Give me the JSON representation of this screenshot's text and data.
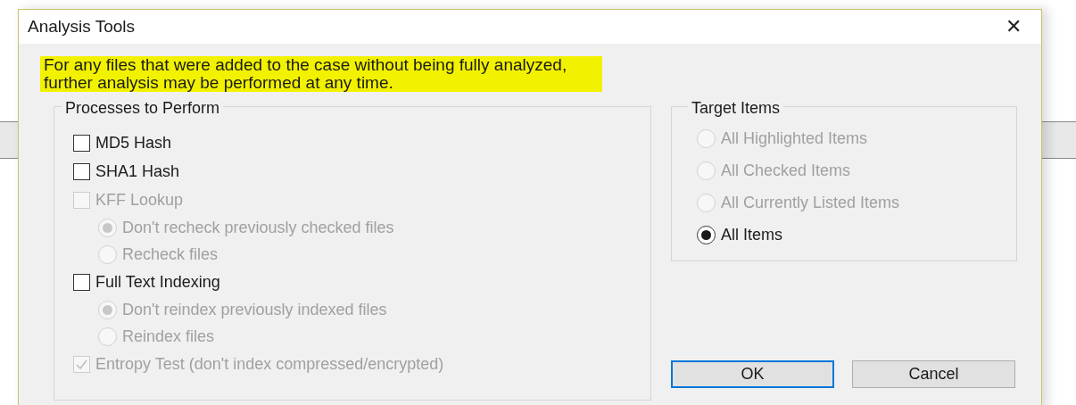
{
  "window": {
    "title": "Analysis Tools",
    "close": "✕"
  },
  "notice": {
    "text": "For any files that were added to the case without being fully analyzed, further analysis may be performed at any time.",
    "highlighted": true
  },
  "processes": {
    "title": "Processes to Perform",
    "items": [
      {
        "kind": "checkbox",
        "label": "MD5 Hash",
        "checked": false,
        "disabled": false
      },
      {
        "kind": "checkbox",
        "label": "SHA1 Hash",
        "checked": false,
        "disabled": false
      },
      {
        "kind": "checkbox",
        "label": "KFF Lookup",
        "checked": false,
        "disabled": true,
        "children": [
          {
            "kind": "radio",
            "label": "Don't recheck previously checked files",
            "selected": true,
            "disabled": true
          },
          {
            "kind": "radio",
            "label": "Recheck files",
            "selected": false,
            "disabled": true
          }
        ]
      },
      {
        "kind": "checkbox",
        "label": "Full Text Indexing",
        "checked": false,
        "disabled": false,
        "children": [
          {
            "kind": "radio",
            "label": "Don't reindex previously indexed files",
            "selected": true,
            "disabled": true
          },
          {
            "kind": "radio",
            "label": "Reindex files",
            "selected": false,
            "disabled": true
          }
        ]
      },
      {
        "kind": "checkbox",
        "label": "Entropy Test (don't index compressed/encrypted)",
        "checked": true,
        "disabled": true
      }
    ]
  },
  "target": {
    "title": "Target Items",
    "items": [
      {
        "kind": "radio",
        "label": "All Highlighted Items",
        "selected": false,
        "disabled": true
      },
      {
        "kind": "radio",
        "label": "All Checked Items",
        "selected": false,
        "disabled": true
      },
      {
        "kind": "radio",
        "label": "All Currently Listed Items",
        "selected": false,
        "disabled": true
      },
      {
        "kind": "radio",
        "label": "All Items",
        "selected": true,
        "disabled": false
      }
    ]
  },
  "buttons": [
    {
      "label": "OK",
      "default": true
    },
    {
      "label": "Cancel",
      "default": false
    }
  ]
}
